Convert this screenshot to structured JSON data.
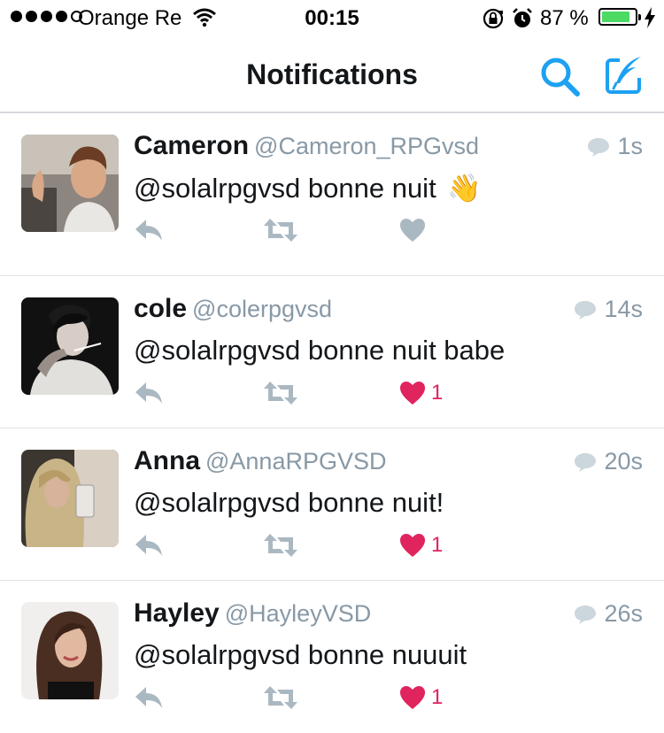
{
  "status_bar": {
    "carrier": "Orange Re",
    "time": "00:15",
    "battery_percent": "87 %",
    "battery_level": 0.87,
    "icons": [
      "signal-dots-icon",
      "wifi-icon",
      "rotation-lock-icon",
      "alarm-icon",
      "battery-icon",
      "charging-bolt-icon"
    ]
  },
  "nav": {
    "title": "Notifications",
    "icons": [
      "search-icon",
      "compose-tweet-icon"
    ]
  },
  "colors": {
    "accent": "#1da1f2",
    "like_active": "#e0245e",
    "muted": "#8899a6",
    "icon_gray": "#aab8c2",
    "battery_green": "#4cd964"
  },
  "notifications": [
    {
      "name": "Cameron",
      "handle": "@Cameron_RPGvsd",
      "time": "1s",
      "text": "@solalrpgvsd bonne nuit",
      "emoji": "👋",
      "liked": false,
      "like_count": ""
    },
    {
      "name": "cole",
      "handle": "@colerpgvsd",
      "time": "14s",
      "text": "@solalrpgvsd bonne nuit babe",
      "liked": true,
      "like_count": "1"
    },
    {
      "name": "Anna",
      "handle": "@AnnaRPGVSD",
      "time": "20s",
      "text": "@solalrpgvsd bonne nuit!",
      "liked": true,
      "like_count": "1"
    },
    {
      "name": "Hayley",
      "handle": "@HayleyVSD",
      "time": "26s",
      "text": "@solalrpgvsd bonne nuuuit",
      "liked": true,
      "like_count": "1"
    }
  ]
}
